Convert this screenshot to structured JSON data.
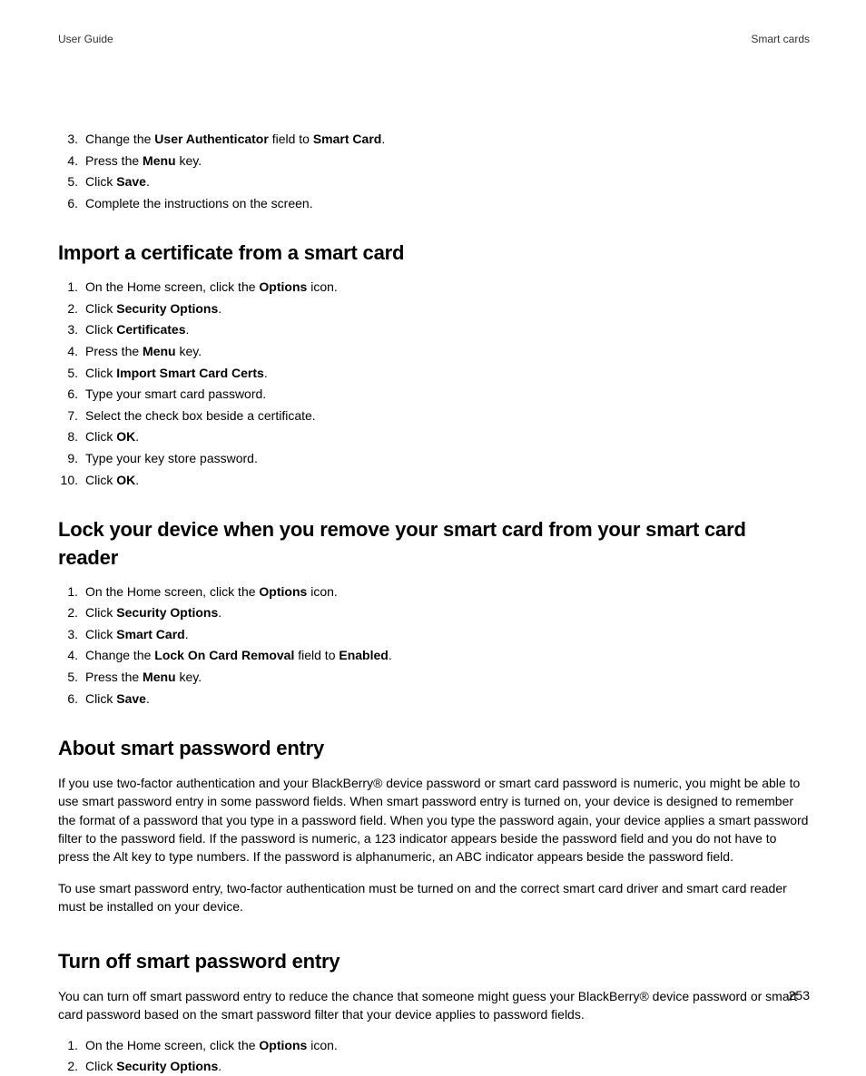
{
  "header": {
    "left": "User Guide",
    "right": "Smart cards"
  },
  "topList": {
    "start": 3,
    "items": [
      {
        "pre": "Change the ",
        "b1": "User Authenticator",
        "mid": " field to ",
        "b2": "Smart Card",
        "post": "."
      },
      {
        "pre": "Press the ",
        "b1": "Menu",
        "post": " key."
      },
      {
        "pre": "Click ",
        "b1": "Save",
        "post": "."
      },
      {
        "pre": "Complete the instructions on the screen."
      }
    ]
  },
  "sec1": {
    "heading": "Import a certificate from a smart card",
    "items": [
      {
        "pre": "On the Home screen, click the ",
        "b1": "Options",
        "post": " icon."
      },
      {
        "pre": "Click ",
        "b1": "Security Options",
        "post": "."
      },
      {
        "pre": "Click ",
        "b1": "Certificates",
        "post": "."
      },
      {
        "pre": "Press the ",
        "b1": "Menu",
        "post": " key."
      },
      {
        "pre": "Click ",
        "b1": "Import Smart Card Certs",
        "post": "."
      },
      {
        "pre": "Type your smart card password."
      },
      {
        "pre": "Select the check box beside a certificate."
      },
      {
        "pre": "Click ",
        "b1": "OK",
        "post": "."
      },
      {
        "pre": "Type your key store password."
      },
      {
        "pre": "Click ",
        "b1": "OK",
        "post": "."
      }
    ]
  },
  "sec2": {
    "heading": "Lock your device when you remove your smart card from your smart card reader",
    "items": [
      {
        "pre": "On the Home screen, click the ",
        "b1": "Options",
        "post": " icon."
      },
      {
        "pre": "Click ",
        "b1": "Security Options",
        "post": "."
      },
      {
        "pre": "Click ",
        "b1": "Smart Card",
        "post": "."
      },
      {
        "pre": "Change the ",
        "b1": "Lock On Card Removal",
        "mid": " field to ",
        "b2": "Enabled",
        "post": "."
      },
      {
        "pre": "Press the ",
        "b1": "Menu",
        "post": " key."
      },
      {
        "pre": "Click ",
        "b1": "Save",
        "post": "."
      }
    ]
  },
  "sec3": {
    "heading": "About smart password entry",
    "p1": "If you use two-factor authentication and your BlackBerry® device password or smart card password is numeric, you might be able to use smart password entry in some password fields. When smart password entry is turned on, your device is designed to remember the format of a password that you type in a password field. When you type the password again, your device applies a smart password filter to the password field. If the password is numeric, a 123 indicator appears beside the password field and you do not have to press the Alt key to type numbers. If the password is alphanumeric, an ABC indicator appears beside the password field.",
    "p2": "To use smart password entry, two-factor authentication must be turned on and the correct smart card driver and smart card reader must be installed on your device."
  },
  "sec4": {
    "heading": "Turn off smart password entry",
    "p1": "You can turn off smart password entry to reduce the chance that someone might guess your BlackBerry® device password or smart card password based on the smart password filter that your device applies to password fields.",
    "items": [
      {
        "pre": "On the Home screen, click the ",
        "b1": "Options",
        "post": " icon."
      },
      {
        "pre": "Click ",
        "b1": "Security Options",
        "post": "."
      }
    ]
  },
  "pageNumber": "253"
}
